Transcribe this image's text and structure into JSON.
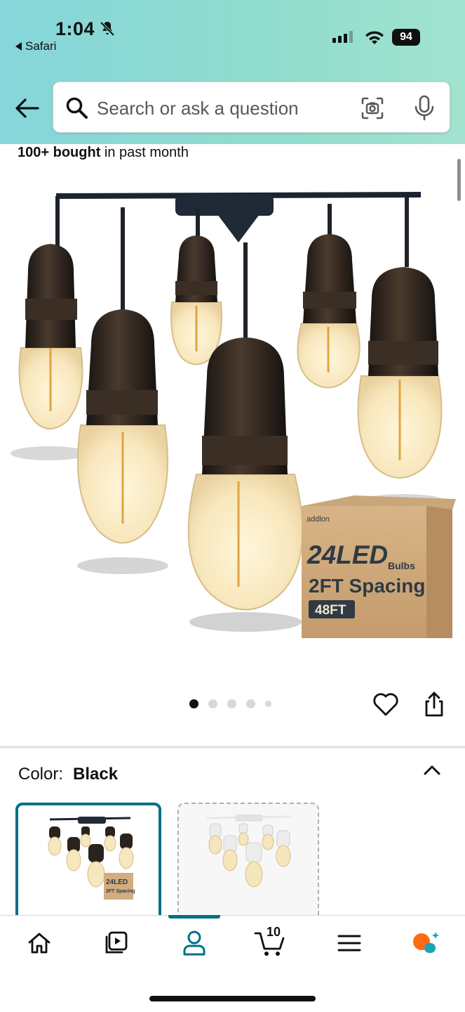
{
  "status_bar": {
    "time": "1:04",
    "back_app": "Safari",
    "battery": "94",
    "icons": [
      "bell-slash-icon",
      "cellular-signal-icon",
      "wifi-icon",
      "battery-icon"
    ]
  },
  "header": {
    "back_icon": "arrow-left-icon",
    "search": {
      "placeholder": "Search or ask a question",
      "value": "",
      "icons": [
        "search-icon",
        "camera-scan-icon",
        "microphone-icon"
      ]
    },
    "gradient_colors": [
      "#86d6db",
      "#a2e3cf"
    ]
  },
  "product": {
    "bought_bold": "100+ bought",
    "bought_rest": " in past month",
    "image": {
      "description_icon": "product-photo-string-lights",
      "box_brand": "addlon",
      "box_line1": "24LED",
      "box_bulbs": "Bulbs",
      "box_line2": "2FT Spacing",
      "box_badge": "48FT"
    },
    "carousel": {
      "total": 5,
      "current": 1
    },
    "actions": [
      "heart-icon",
      "share-icon"
    ]
  },
  "variation": {
    "label": "Color:",
    "selected": "Black",
    "options": [
      {
        "name": "Black",
        "selected": true,
        "box_line1": "24LED",
        "box_line2": "2FT Spacing"
      },
      {
        "name": "White",
        "selected": false
      }
    ]
  },
  "tabbar": {
    "accent": "#007185",
    "items": [
      {
        "name": "home",
        "icon": "home-icon"
      },
      {
        "name": "inspire",
        "icon": "play-stack-icon"
      },
      {
        "name": "account",
        "icon": "person-icon",
        "active": true
      },
      {
        "name": "cart",
        "icon": "cart-icon",
        "count": "10"
      },
      {
        "name": "menu",
        "icon": "hamburger-icon"
      },
      {
        "name": "rufus",
        "icon": "rufus-chat-icon"
      }
    ]
  }
}
